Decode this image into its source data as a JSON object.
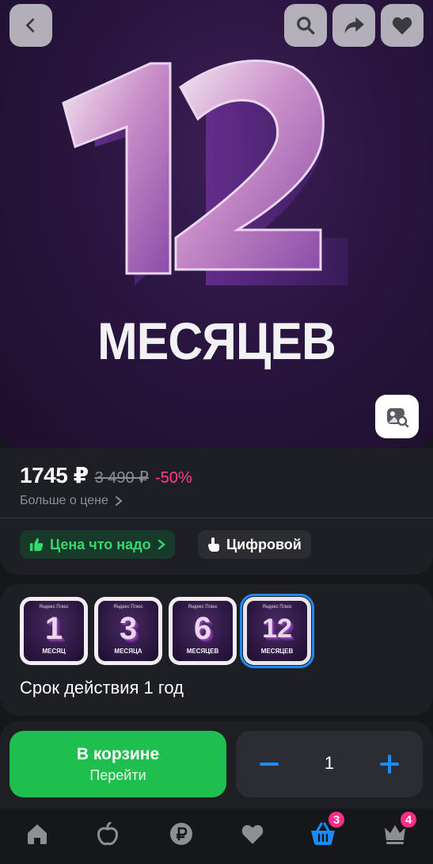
{
  "hero": {
    "number_art": "12",
    "caption": "МЕСЯЦЕВ",
    "buttons": {
      "back_icon": "chevron-left-icon",
      "search_icon": "search-icon",
      "share_icon": "share-icon",
      "favorite_icon": "heart-icon",
      "image_search_icon": "image-search-icon"
    }
  },
  "price": {
    "current": "1745 ₽",
    "old": "3 490 ₽",
    "discount": "-50%",
    "more_label": "Больше о цене",
    "colors": {
      "discount": "#ff3f8a",
      "green": "#35d96b"
    }
  },
  "tags": [
    {
      "label": "Цена что надо",
      "icon": "thumbs-up-icon"
    },
    {
      "label": "Цифровой",
      "icon": "tap-icon"
    }
  ],
  "variants": {
    "items": [
      {
        "brand": "Яндекс Плюс",
        "number": "1",
        "word": "МЕСЯЦ",
        "selected": false
      },
      {
        "brand": "Яндекс Плюс",
        "number": "3",
        "word": "МЕСЯЦА",
        "selected": false
      },
      {
        "brand": "Яндекс Плюс",
        "number": "6",
        "word": "МЕСЯЦЕВ",
        "selected": false
      },
      {
        "brand": "Яндекс Плюс",
        "number": "12",
        "word": "МЕСЯЦЕВ",
        "selected": true
      }
    ],
    "label": "Срок действия 1 год"
  },
  "action_bar": {
    "cart_title": "В корзине",
    "cart_subtitle": "Перейти",
    "quantity": "1",
    "accent": "#1fbf4f",
    "qty_color": "#1a8cff"
  },
  "tab_bar": {
    "items": [
      {
        "icon": "home-icon",
        "badge": ""
      },
      {
        "icon": "catalog-icon",
        "badge": ""
      },
      {
        "icon": "ruble-icon",
        "badge": ""
      },
      {
        "icon": "favorites-icon",
        "badge": ""
      },
      {
        "icon": "basket-icon",
        "badge": "3",
        "active": true
      },
      {
        "icon": "profile-crown-icon",
        "badge": "4"
      }
    ]
  }
}
